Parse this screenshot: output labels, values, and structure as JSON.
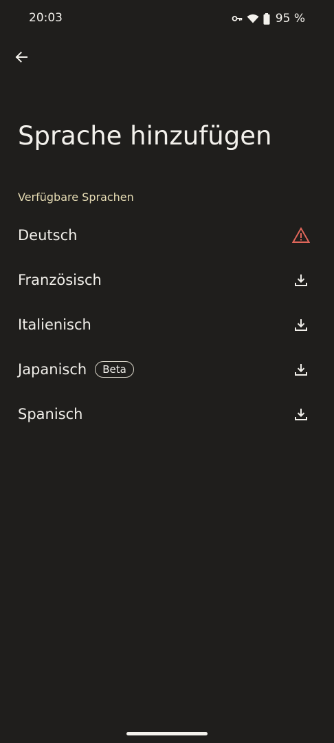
{
  "status_bar": {
    "time": "20:03",
    "battery": "95 %",
    "icons": [
      "vpn-key-icon",
      "wifi-icon",
      "battery-icon"
    ]
  },
  "header": {
    "back_icon": "arrow-back-icon",
    "title": "Sprache hinzufügen"
  },
  "section": {
    "label": "Verfügbare Sprachen"
  },
  "languages": [
    {
      "name": "Deutsch",
      "icon": "warning-icon",
      "icon_color": "#e0665a"
    },
    {
      "name": "Französisch",
      "icon": "download-icon"
    },
    {
      "name": "Italienisch",
      "icon": "download-icon"
    },
    {
      "name": "Japanisch",
      "badge": "Beta",
      "icon": "download-icon"
    },
    {
      "name": "Spanisch",
      "icon": "download-icon"
    }
  ],
  "colors": {
    "background": "#1f1e1c",
    "text": "#f1efea",
    "section_header": "#e6dcb4",
    "warning": "#e0665a"
  }
}
